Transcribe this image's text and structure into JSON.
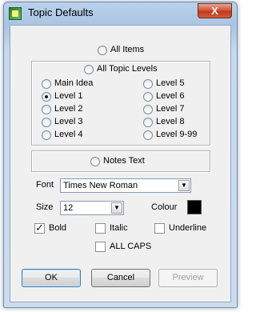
{
  "window": {
    "title": "Topic Defaults",
    "close_symbol": "X"
  },
  "options": {
    "all_items": "All Items",
    "all_topic_levels": "All Topic Levels",
    "notes_text": "Notes Text"
  },
  "levels_left": [
    "Main Idea",
    "Level 1",
    "Level 2",
    "Level 3",
    "Level 4"
  ],
  "levels_right": [
    "Level 5",
    "Level 6",
    "Level 7",
    "Level 8",
    "Level 9-99"
  ],
  "selected_level": "Level 1",
  "font": {
    "label": "Font",
    "value": "Times New Roman"
  },
  "size": {
    "label": "Size",
    "value": "12"
  },
  "colour": {
    "label": "Colour",
    "value": "#000000"
  },
  "styles": {
    "bold": {
      "label": "Bold",
      "checked": true
    },
    "italic": {
      "label": "Italic",
      "checked": false
    },
    "underline": {
      "label": "Underline",
      "checked": false
    },
    "all_caps": {
      "label": "ALL CAPS",
      "checked": false
    }
  },
  "buttons": {
    "ok": "OK",
    "cancel": "Cancel",
    "preview": "Preview"
  }
}
